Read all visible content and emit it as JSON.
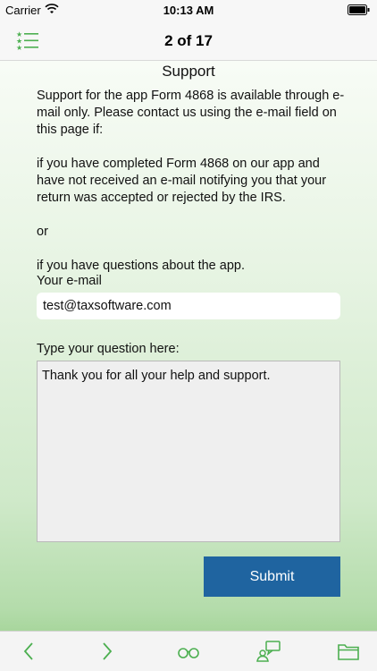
{
  "status_bar": {
    "carrier": "Carrier",
    "time": "10:13 AM",
    "icons": [
      "wifi-icon",
      "battery-icon"
    ]
  },
  "nav": {
    "title": "2 of 17",
    "left_icon": "list-icon"
  },
  "content": {
    "title": "Support",
    "paragraphs": [
      "Support for the app Form 4868 is available through e-mail only. Please contact us using the e-mail field on this page if:",
      "if you have completed Form 4868 on our app and have not received an e-mail notifying you that your return was accepted or rejected by the IRS.",
      "or",
      "if you have questions about the app."
    ],
    "email_label": "Your e-mail",
    "email_value": "test@taxsoftware.com",
    "question_label": "Type your question here:",
    "question_value": "Thank you for all your help and support.",
    "submit_label": "Submit"
  },
  "toolbar": {
    "icons": [
      "back-arrow-icon",
      "forward-arrow-icon",
      "glasses-icon",
      "chat-icon",
      "folder-icon"
    ]
  },
  "colors": {
    "accent_green": "#4caf50",
    "submit_blue": "#1f64a0",
    "background_green": "#a8d69d"
  }
}
